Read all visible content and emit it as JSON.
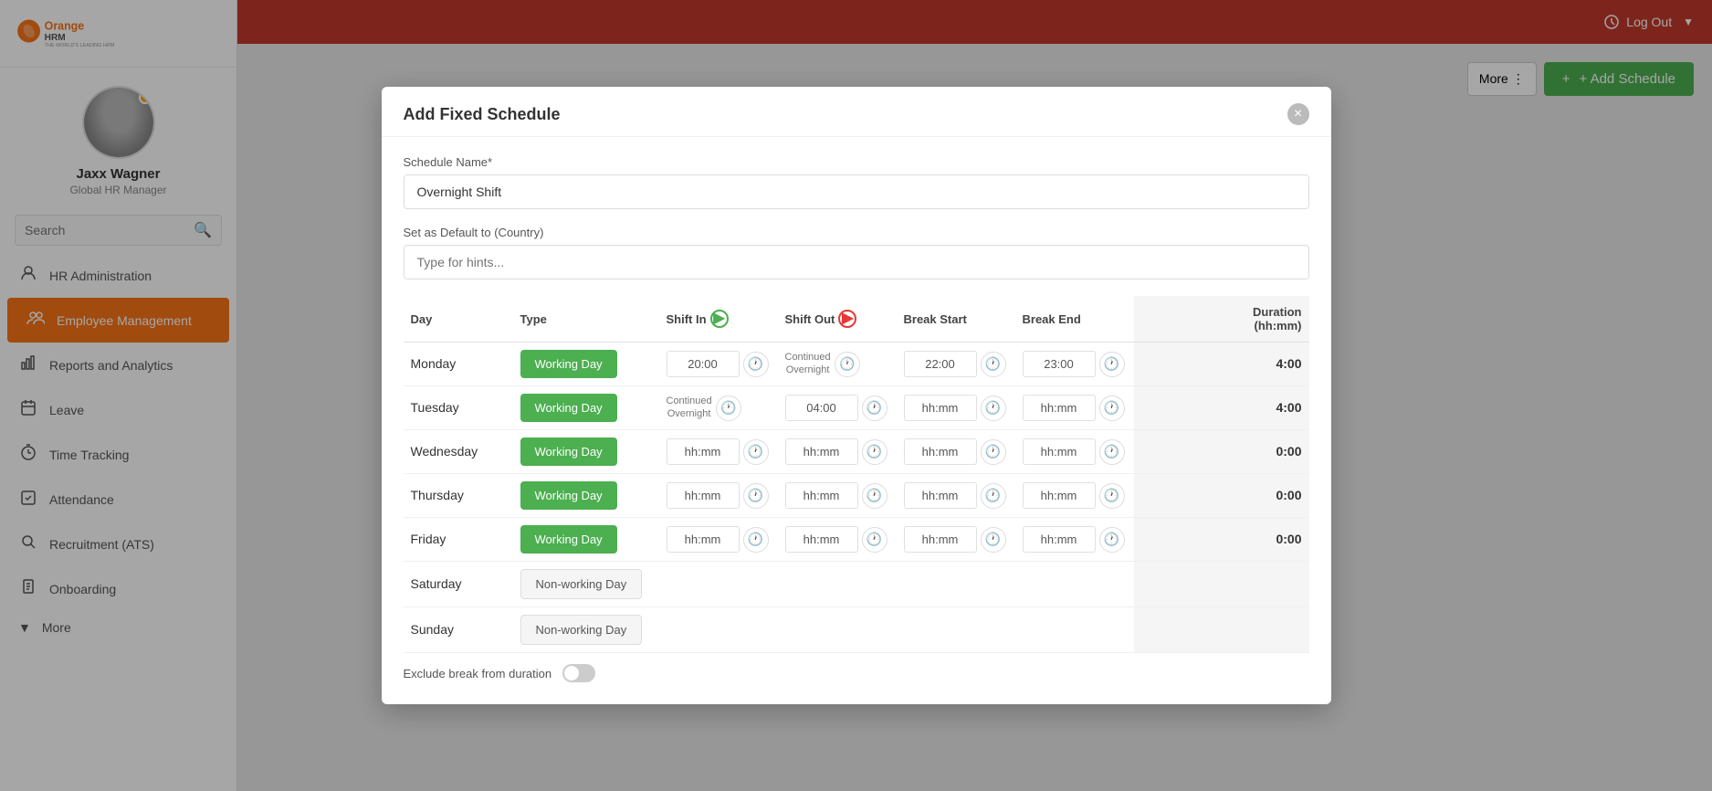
{
  "app": {
    "title": "OrangeHRM",
    "tagline": "THE WORLD'S LEADING HRM",
    "logo_color": "#f97316"
  },
  "topbar": {
    "logout_label": "Log Out",
    "bg_color": "#c0392b"
  },
  "profile": {
    "name": "Jaxx Wagner",
    "role": "Global HR Manager"
  },
  "search": {
    "placeholder": "Search",
    "label": "Search"
  },
  "nav": [
    {
      "id": "hr-administration",
      "label": "HR Administration",
      "icon": "👤"
    },
    {
      "id": "employee-management",
      "label": "Employee Management",
      "icon": "👥",
      "active": true
    },
    {
      "id": "reports-analytics",
      "label": "Reports and Analytics",
      "icon": "📊"
    },
    {
      "id": "leave",
      "label": "Leave",
      "icon": "🚪"
    },
    {
      "id": "time-tracking",
      "label": "Time Tracking",
      "icon": "⏱"
    },
    {
      "id": "attendance",
      "label": "Attendance",
      "icon": "📅"
    },
    {
      "id": "recruitment",
      "label": "Recruitment (ATS)",
      "icon": "🔍"
    },
    {
      "id": "onboarding",
      "label": "Onboarding",
      "icon": "📋"
    }
  ],
  "more_nav": {
    "label": "More",
    "icon": "▾"
  },
  "content": {
    "more_btn": "More ⋮",
    "add_schedule_btn": "+ Add Schedule"
  },
  "modal": {
    "title": "Add Fixed Schedule",
    "close_btn": "×",
    "schedule_name_label": "Schedule Name*",
    "schedule_name_value": "Overnight Shift",
    "country_label": "Set as Default to (Country)",
    "country_placeholder": "Type for hints...",
    "table": {
      "headers": {
        "day": "Day",
        "type": "Type",
        "shift_in": "Shift In",
        "shift_out": "Shift Out",
        "break_start": "Break Start",
        "break_end": "Break End",
        "duration": "Duration\n(hh:mm)"
      },
      "rows": [
        {
          "day": "Monday",
          "type": "Working Day",
          "type_style": "green",
          "shift_in": "20:00",
          "shift_out": "Continued\nOvernight",
          "break_start": "22:00",
          "break_end": "23:00",
          "duration": "4:00"
        },
        {
          "day": "Tuesday",
          "type": "Working Day",
          "type_style": "green",
          "shift_in": "Continued\nOvernight",
          "shift_out": "04:00",
          "break_start": "hh:mm",
          "break_end": "hh:mm",
          "duration": "4:00"
        },
        {
          "day": "Wednesday",
          "type": "Working Day",
          "type_style": "green",
          "shift_in": "hh:mm",
          "shift_out": "hh:mm",
          "break_start": "hh:mm",
          "break_end": "hh:mm",
          "duration": "0:00"
        },
        {
          "day": "Thursday",
          "type": "Working Day",
          "type_style": "green",
          "shift_in": "hh:mm",
          "shift_out": "hh:mm",
          "break_start": "hh:mm",
          "break_end": "hh:mm",
          "duration": "0:00"
        },
        {
          "day": "Friday",
          "type": "Working Day",
          "type_style": "green",
          "shift_in": "hh:mm",
          "shift_out": "hh:mm",
          "break_start": "hh:mm",
          "break_end": "hh:mm",
          "duration": "0:00"
        },
        {
          "day": "Saturday",
          "type": "Non-working Day",
          "type_style": "grey",
          "shift_in": "",
          "shift_out": "",
          "break_start": "",
          "break_end": "",
          "duration": ""
        },
        {
          "day": "Sunday",
          "type": "Non-working Day",
          "type_style": "grey",
          "shift_in": "",
          "shift_out": "",
          "break_start": "",
          "break_end": "",
          "duration": ""
        }
      ]
    },
    "exclude_break_label": "Exclude break from duration",
    "exclude_break_on": false
  }
}
